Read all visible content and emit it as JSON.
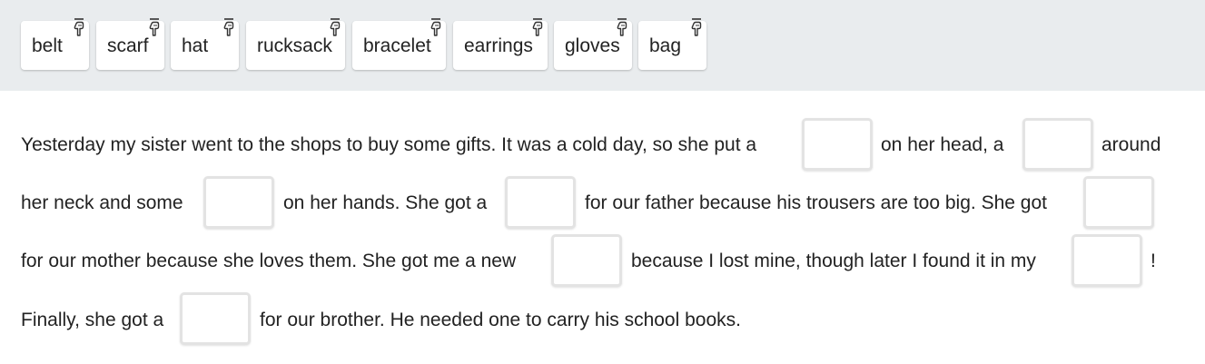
{
  "word_bank": {
    "chips": [
      {
        "label": "belt",
        "icon": "drag-handle-icon"
      },
      {
        "label": "scarf",
        "icon": "drag-handle-icon"
      },
      {
        "label": "hat",
        "icon": "drag-handle-icon"
      },
      {
        "label": "rucksack",
        "icon": "drag-handle-icon"
      },
      {
        "label": "bracelet",
        "icon": "drag-handle-icon"
      },
      {
        "label": "earrings",
        "icon": "drag-handle-icon"
      },
      {
        "label": "gloves",
        "icon": "drag-handle-icon"
      },
      {
        "label": "bag",
        "icon": "drag-handle-icon"
      }
    ]
  },
  "passage": {
    "line1": {
      "s1": "Yesterday my sister went to the shops to buy some gifts. It was a cold day, so she put a",
      "s2": "on her head, a",
      "s3": "around"
    },
    "line2": {
      "s1": "her neck and some",
      "s2": "on her hands. She got a",
      "s3": "for our father because his trousers are too big. She got"
    },
    "line3": {
      "s1": "for our mother because she loves them. She got me a new",
      "s2": "because I lost mine, though later I found it in my",
      "s3": "!"
    },
    "line4": {
      "s1": "Finally, she got a",
      "s2": "for our brother. He needed one to carry his school books."
    }
  },
  "colors": {
    "bank_background": "#e9ecee",
    "chip_background": "#ffffff",
    "gap_border": "#e3e3e3",
    "text": "#222222"
  }
}
